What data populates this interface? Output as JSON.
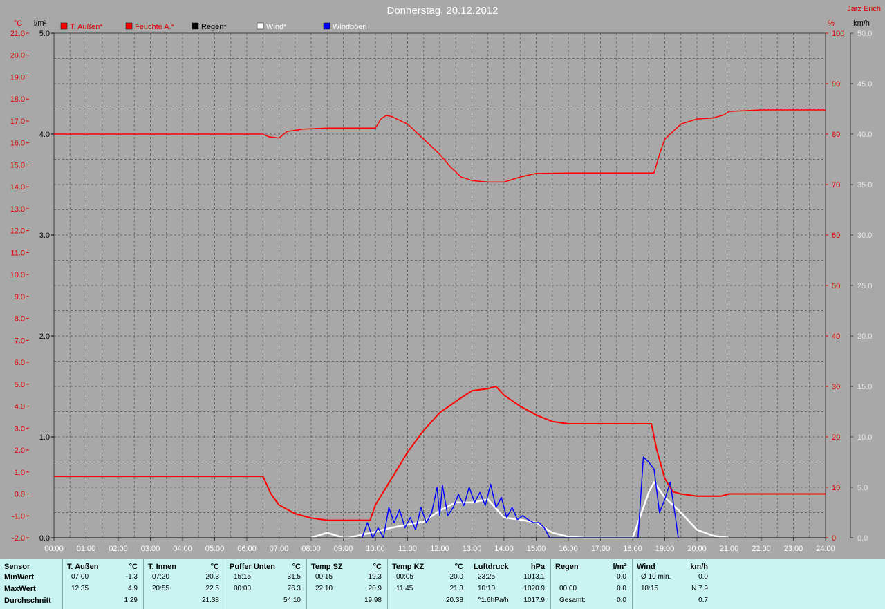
{
  "chart_data": {
    "type": "line",
    "title": "Donnerstag, 20.12.2012",
    "author": "Jarz Erich",
    "axes": {
      "temp": {
        "unit": "°C",
        "range": [
          -2.0,
          21.0
        ],
        "ticks": [
          "21.0",
          "20.0",
          "19.0",
          "18.0",
          "17.0",
          "16.0",
          "15.0",
          "14.0",
          "13.0",
          "12.0",
          "11.0",
          "10.0",
          "9.0",
          "8.0",
          "7.0",
          "6.0",
          "5.0",
          "4.0",
          "3.0",
          "2.0",
          "1.0",
          "0.0",
          "-1.0",
          "-2.0"
        ]
      },
      "rain": {
        "unit": "l/m²",
        "range": [
          0.0,
          5.0
        ],
        "ticks": [
          "5.0",
          "4.0",
          "3.0",
          "2.0",
          "1.0",
          "0.0"
        ]
      },
      "humidity": {
        "unit": "%",
        "range": [
          0,
          100
        ],
        "ticks": [
          "100",
          "90",
          "80",
          "70",
          "60",
          "50",
          "40",
          "30",
          "20",
          "10",
          "0"
        ]
      },
      "wind": {
        "unit": "km/h",
        "range": [
          0.0,
          50.0
        ],
        "ticks": [
          "50.0",
          "45.0",
          "40.0",
          "35.0",
          "30.0",
          "25.0",
          "20.0",
          "15.0",
          "10.0",
          "5.0",
          "0.0"
        ]
      },
      "x": {
        "unit": "time",
        "range": [
          0,
          24
        ],
        "ticks": [
          "00:00",
          "01:00",
          "02:00",
          "03:00",
          "04:00",
          "05:00",
          "06:00",
          "07:00",
          "08:00",
          "09:00",
          "10:00",
          "11:00",
          "12:00",
          "13:00",
          "14:00",
          "15:00",
          "16:00",
          "17:00",
          "18:00",
          "19:00",
          "20:00",
          "21:00",
          "22:00",
          "23:00",
          "24:00"
        ]
      }
    },
    "grid": true,
    "legend_position": "top-left",
    "legend": [
      {
        "name": "T. Außen*",
        "color": "#ff0000"
      },
      {
        "name": "Feuchte A.*",
        "color": "#ff0000"
      },
      {
        "name": "Regen*",
        "color": "#000000"
      },
      {
        "name": "Wind*",
        "color": "#ffffff"
      },
      {
        "name": "Windböen",
        "color": "#0000ff"
      }
    ],
    "series": [
      {
        "name": "T. Außen*",
        "axis": "temp",
        "color": "#ff0000",
        "x": [
          "00:00",
          "06:30",
          "06:45",
          "07:00",
          "07:30",
          "08:00",
          "08:30",
          "09:00",
          "09:30",
          "09:50",
          "10:00",
          "10:30",
          "11:00",
          "11:30",
          "12:00",
          "12:35",
          "13:00",
          "13:30",
          "13:45",
          "14:00",
          "14:30",
          "15:00",
          "15:30",
          "16:00",
          "16:30",
          "17:00",
          "18:00",
          "18:35",
          "18:45",
          "19:00",
          "19:15",
          "19:30",
          "20:00",
          "20:45",
          "21:00",
          "22:00",
          "23:00",
          "24:00"
        ],
        "y": [
          0.8,
          0.8,
          0.0,
          -0.5,
          -0.9,
          -1.1,
          -1.2,
          -1.2,
          -1.2,
          -1.2,
          -0.5,
          0.7,
          1.9,
          2.9,
          3.7,
          4.3,
          4.7,
          4.8,
          4.9,
          4.5,
          4.0,
          3.6,
          3.3,
          3.2,
          3.2,
          3.2,
          3.2,
          3.2,
          2.0,
          0.7,
          0.1,
          0.0,
          -0.1,
          -0.1,
          0.0,
          0.0,
          0.0,
          0.0
        ]
      },
      {
        "name": "Feuchte A.*",
        "axis": "humidity",
        "color": "#ff0000",
        "x": [
          "00:00",
          "06:30",
          "06:40",
          "07:00",
          "07:15",
          "07:45",
          "08:30",
          "09:30",
          "10:00",
          "10:10",
          "10:20",
          "10:30",
          "11:00",
          "11:30",
          "12:00",
          "12:20",
          "12:40",
          "13:00",
          "13:30",
          "14:00",
          "14:30",
          "15:00",
          "16:00",
          "17:00",
          "18:00",
          "18:40",
          "18:50",
          "19:00",
          "19:30",
          "20:00",
          "20:30",
          "20:50",
          "21:00",
          "22:00",
          "24:00"
        ],
        "y": [
          80.0,
          80.0,
          79.5,
          79.2,
          80.5,
          81.0,
          81.2,
          81.2,
          81.2,
          83.0,
          83.7,
          83.5,
          82.0,
          79.0,
          76.0,
          73.5,
          71.5,
          70.8,
          70.5,
          70.5,
          71.5,
          72.2,
          72.3,
          72.3,
          72.3,
          72.3,
          76.0,
          79.0,
          82.0,
          83.0,
          83.2,
          83.8,
          84.5,
          84.8,
          84.8
        ]
      },
      {
        "name": "Wind*",
        "axis": "wind",
        "color": "#ffffff",
        "x": [
          "08:00",
          "08:30",
          "09:00",
          "09:10",
          "10:00",
          "10:30",
          "11:00",
          "11:30",
          "12:00",
          "12:30",
          "13:00",
          "13:30",
          "14:00",
          "14:30",
          "15:00",
          "15:30",
          "16:00",
          "16:30",
          "18:00",
          "18:30",
          "18:40",
          "19:00",
          "19:30",
          "20:00",
          "20:30",
          "21:00"
        ],
        "y": [
          0.0,
          0.5,
          0.0,
          0.0,
          0.6,
          1.0,
          1.3,
          1.6,
          2.7,
          3.5,
          3.5,
          3.8,
          2.0,
          1.8,
          1.5,
          0.5,
          0.1,
          0.0,
          0.0,
          4.5,
          5.5,
          4.0,
          2.5,
          0.8,
          0.2,
          0.0
        ]
      },
      {
        "name": "Windböen",
        "axis": "wind",
        "color": "#0000ff",
        "x": [
          "09:35",
          "09:45",
          "09:55",
          "10:05",
          "10:15",
          "10:25",
          "10:35",
          "10:45",
          "10:55",
          "11:05",
          "11:15",
          "11:25",
          "11:35",
          "11:45",
          "11:55",
          "12:00",
          "12:05",
          "12:15",
          "12:25",
          "12:35",
          "12:45",
          "12:55",
          "13:05",
          "13:15",
          "13:25",
          "13:35",
          "13:45",
          "13:55",
          "14:05",
          "14:15",
          "14:25",
          "14:35",
          "14:45",
          "14:55",
          "15:05",
          "15:15",
          "15:25",
          "18:10",
          "18:20",
          "18:30",
          "18:40",
          "18:50",
          "19:00",
          "19:10",
          "19:20",
          "19:25"
        ],
        "y": [
          0.0,
          1.5,
          0.0,
          1.0,
          0.0,
          3.0,
          1.5,
          2.8,
          1.0,
          2.0,
          0.8,
          3.0,
          1.5,
          2.5,
          5.0,
          2.2,
          5.2,
          2.2,
          3.0,
          4.3,
          3.2,
          5.0,
          3.5,
          4.5,
          3.2,
          5.3,
          3.0,
          4.0,
          2.0,
          3.0,
          1.8,
          2.2,
          1.8,
          1.5,
          1.5,
          1.0,
          0.0,
          0.0,
          8.0,
          7.5,
          6.8,
          2.5,
          3.8,
          5.5,
          2.0,
          0.0
        ]
      },
      {
        "name": "Regen*",
        "axis": "rain",
        "color": "#000000",
        "x": [
          "00:00",
          "24:00"
        ],
        "y": [
          0.0,
          0.0
        ]
      }
    ]
  },
  "stats": {
    "columns": [
      {
        "header": "Sensor",
        "unit": "",
        "min_time": "MinWert",
        "min_val": "",
        "max_time": "MaxWert",
        "max_val": "",
        "avg_time": "Durchschnitt",
        "avg_val": ""
      },
      {
        "header": "T. Außen",
        "unit": "°C",
        "min_time": "07:00",
        "min_val": "-1.3",
        "max_time": "12:35",
        "max_val": "4.9",
        "avg_time": "",
        "avg_val": "1.29"
      },
      {
        "header": "T. Innen",
        "unit": "°C",
        "min_time": "07:20",
        "min_val": "20.3",
        "max_time": "20:55",
        "max_val": "22.5",
        "avg_time": "",
        "avg_val": "21.38"
      },
      {
        "header": "Puffer Unten",
        "unit": "°C",
        "min_time": "15:15",
        "min_val": "31.5",
        "max_time": "00:00",
        "max_val": "76.3",
        "avg_time": "",
        "avg_val": "54.10"
      },
      {
        "header": "Temp SZ",
        "unit": "°C",
        "min_time": "00:15",
        "min_val": "19.3",
        "max_time": "22:10",
        "max_val": "20.9",
        "avg_time": "",
        "avg_val": "19.98"
      },
      {
        "header": "Temp KZ",
        "unit": "°C",
        "min_time": "00:05",
        "min_val": "20.0",
        "max_time": "11:45",
        "max_val": "21.3",
        "avg_time": "",
        "avg_val": "20.38"
      },
      {
        "header": "Luftdruck",
        "unit": "hPa",
        "min_time": "23:25",
        "min_val": "1013.1",
        "max_time": "10:10",
        "max_val": "1020.9",
        "avg_time": "^1.6hPa/h",
        "avg_val": "1017.9"
      },
      {
        "header": "Regen",
        "unit": "l/m²",
        "min_time": "",
        "min_val": "0.0",
        "max_time": "00:00",
        "max_val": "0.0",
        "avg_time": "Gesamt:",
        "avg_val": "0.0"
      },
      {
        "header": "Wind",
        "unit": "km/h",
        "min_time": "Ø 10 min.",
        "min_val": "0.0",
        "max_time": "18:15",
        "max_val": "N 7.9",
        "avg_time": "",
        "avg_val": "0.7"
      }
    ]
  }
}
